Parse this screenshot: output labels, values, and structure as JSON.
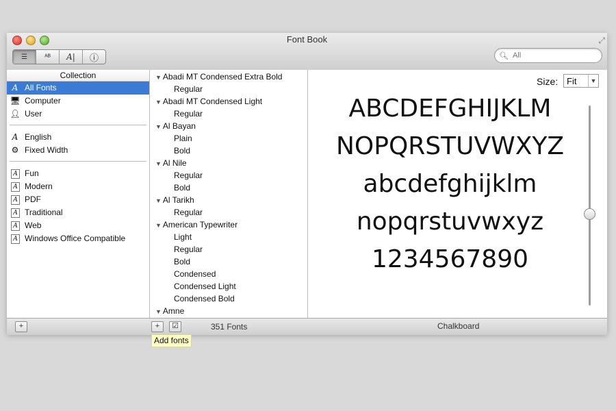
{
  "window": {
    "title": "Font Book"
  },
  "toolbar": {
    "view_buttons": [
      {
        "name": "list-view-icon",
        "glyph": "☰"
      },
      {
        "name": "sample-view-icon",
        "glyph": "ᴬᴮᶜ"
      },
      {
        "name": "custom-view-icon",
        "glyph": "A|"
      },
      {
        "name": "info-view-icon",
        "glyph": "ⓘ"
      }
    ],
    "search_placeholder": "All"
  },
  "collection": {
    "header": "Collection",
    "groups": [
      [
        {
          "label": "All Fonts",
          "icon": "font-icon",
          "selected": true
        },
        {
          "label": "Computer",
          "icon": "computer-icon"
        },
        {
          "label": "User",
          "icon": "user-icon"
        }
      ],
      [
        {
          "label": "English",
          "icon": "font-icon"
        },
        {
          "label": "Fixed Width",
          "icon": "gear-icon"
        }
      ],
      [
        {
          "label": "Fun",
          "icon": "collection-icon"
        },
        {
          "label": "Modern",
          "icon": "collection-icon"
        },
        {
          "label": "PDF",
          "icon": "collection-icon"
        },
        {
          "label": "Traditional",
          "icon": "collection-icon"
        },
        {
          "label": "Web",
          "icon": "collection-icon"
        },
        {
          "label": "Windows Office Compatible",
          "icon": "collection-icon"
        }
      ]
    ]
  },
  "fonts": [
    {
      "family": "Abadi MT Condensed Extra Bold",
      "faces": [
        "Regular"
      ]
    },
    {
      "family": "Abadi MT Condensed Light",
      "faces": [
        "Regular"
      ]
    },
    {
      "family": "Al Bayan",
      "faces": [
        "Plain",
        "Bold"
      ]
    },
    {
      "family": "Al Nile",
      "faces": [
        "Regular",
        "Bold"
      ]
    },
    {
      "family": "Al Tarikh",
      "faces": [
        "Regular"
      ]
    },
    {
      "family": "American Typewriter",
      "faces": [
        "Light",
        "Regular",
        "Bold",
        "Condensed",
        "Condensed Light",
        "Condensed Bold"
      ]
    },
    {
      "family": "Amne",
      "faces": []
    }
  ],
  "preview": {
    "size_label": "Size:",
    "size_value": "Fit",
    "lines": [
      "ABCDEFGHIJKLM",
      "NOPQRSTUVWXYZ",
      "abcdefghijklm",
      "nopqrstuvwxyz",
      "1234567890"
    ]
  },
  "status": {
    "font_count": "351 Fonts",
    "selected_font": "Chalkboard",
    "tooltip": "Add fonts"
  }
}
